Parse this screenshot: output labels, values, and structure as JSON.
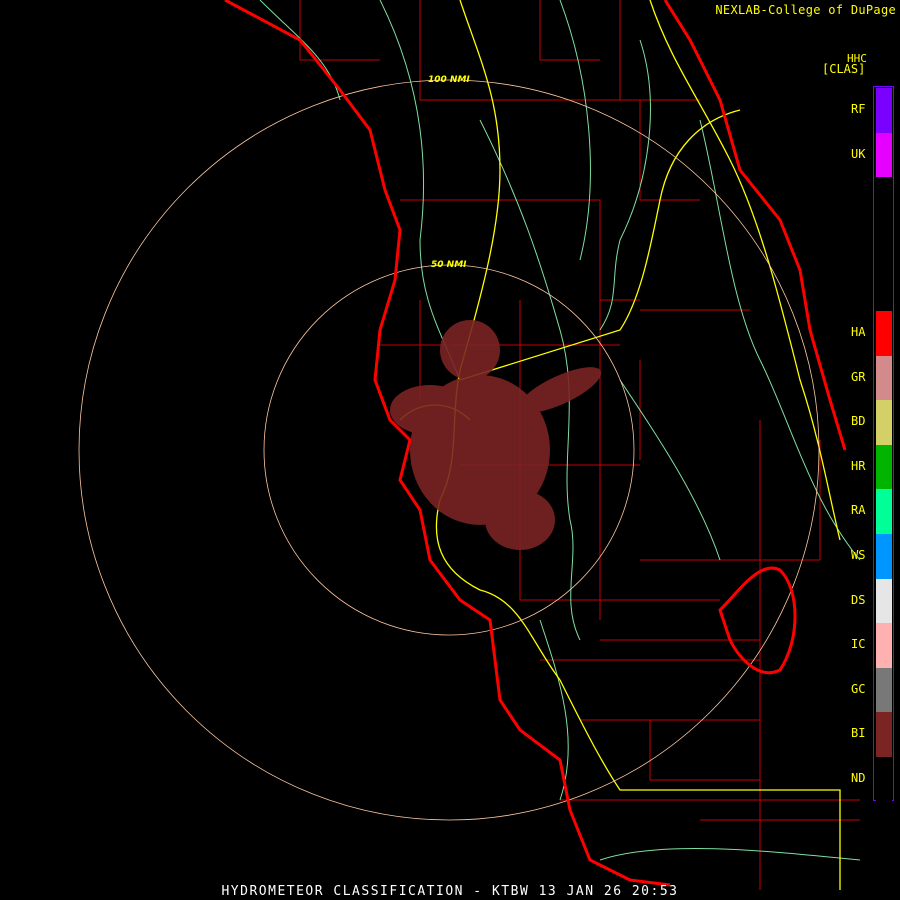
{
  "header": {
    "credit": "NEXLAB-College of DuPage",
    "product_code": "HHC",
    "product_type": "[CLAS]"
  },
  "footer": {
    "title": "HYDROMETEOR CLASSIFICATION - KTBW 13 JAN 26 20:53"
  },
  "range_rings": {
    "inner_label": "50 NMI",
    "outer_label": "100 NMI"
  },
  "legend": [
    {
      "code": "RF",
      "color": "#7a00ff"
    },
    {
      "code": "UK",
      "color": "#e600ff"
    },
    {
      "code": "",
      "color": "#000000"
    },
    {
      "code": "",
      "color": "#000000"
    },
    {
      "code": "",
      "color": "#000000"
    },
    {
      "code": "HA",
      "color": "#ff0000"
    },
    {
      "code": "GR",
      "color": "#d28a8a"
    },
    {
      "code": "BD",
      "color": "#d2d066"
    },
    {
      "code": "HR",
      "color": "#00b400"
    },
    {
      "code": "RA",
      "color": "#00ff96"
    },
    {
      "code": "WS",
      "color": "#0096ff"
    },
    {
      "code": "DS",
      "color": "#e6e6e6"
    },
    {
      "code": "IC",
      "color": "#ffb0b0"
    },
    {
      "code": "GC",
      "color": "#787878"
    },
    {
      "code": "BI",
      "color": "#7a2424"
    },
    {
      "code": "ND",
      "color": "#000000"
    }
  ],
  "colors": {
    "coast": "#ff0000",
    "counties": "#c80000",
    "highways": "#ffff00",
    "rivers": "#80e0a0",
    "rings": "#ffc8a0",
    "echo": "#7a2424"
  }
}
